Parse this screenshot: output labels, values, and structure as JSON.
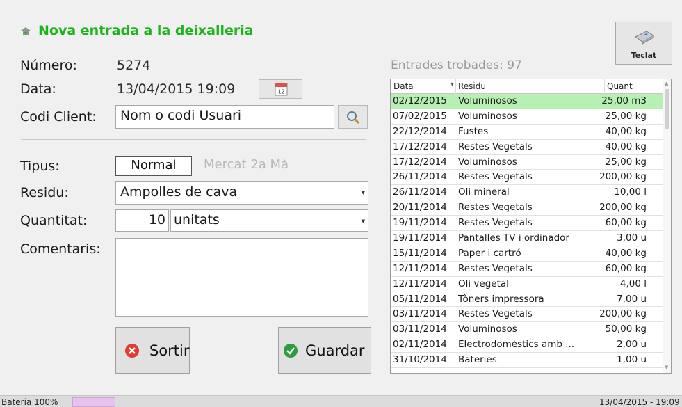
{
  "header": {
    "title": "Nova entrada a la deixalleria"
  },
  "form": {
    "numero_label": "Número:",
    "numero_value": "5274",
    "data_label": "Data:",
    "data_value": "13/04/2015 19:09",
    "codi_label": "Codi Client:",
    "codi_value": "Nom o codi Usuari",
    "tipus_label": "Tipus:",
    "tipus_options": [
      "Normal",
      "Mercat 2a Mà"
    ],
    "tipus_selected": "Normal",
    "residu_label": "Residu:",
    "residu_value": "Ampolles de cava",
    "quantitat_label": "Quantitat:",
    "quantitat_value": "10",
    "unit_value": "unitats",
    "comentaris_label": "Comentaris:",
    "comentaris_value": ""
  },
  "buttons": {
    "sortir": "Sortir",
    "guardar": "Guardar",
    "teclat": "Teclat"
  },
  "calendar_badge": "12",
  "list": {
    "found_text": "Entrades trobades: 97",
    "headers": {
      "data": "Data",
      "residu": "Residu",
      "quant": "Quant"
    },
    "rows": [
      {
        "date": "02/12/2015",
        "residu": "Voluminosos",
        "quant": "25,00 m3",
        "selected": true
      },
      {
        "date": "07/02/2015",
        "residu": "Voluminosos",
        "quant": "25,00 kg"
      },
      {
        "date": "22/12/2014",
        "residu": "Fustes",
        "quant": "40,00 kg"
      },
      {
        "date": "17/12/2014",
        "residu": "Restes Vegetals",
        "quant": "40,00 kg"
      },
      {
        "date": "17/12/2014",
        "residu": "Voluminosos",
        "quant": "25,00 kg"
      },
      {
        "date": "26/11/2014",
        "residu": "Restes Vegetals",
        "quant": "200,00 kg"
      },
      {
        "date": "26/11/2014",
        "residu": "Oli mineral",
        "quant": "10,00 l"
      },
      {
        "date": "20/11/2014",
        "residu": "Restes Vegetals",
        "quant": "200,00 kg"
      },
      {
        "date": "19/11/2014",
        "residu": "Restes Vegetals",
        "quant": "60,00 kg"
      },
      {
        "date": "19/11/2014",
        "residu": "Pantalles TV i ordinador",
        "quant": "3,00 u"
      },
      {
        "date": "15/11/2014",
        "residu": "Paper i cartró",
        "quant": "40,00 kg"
      },
      {
        "date": "12/11/2014",
        "residu": "Restes Vegetals",
        "quant": "60,00 kg"
      },
      {
        "date": "12/11/2014",
        "residu": "Oli vegetal",
        "quant": "4,00 l"
      },
      {
        "date": "05/11/2014",
        "residu": "Tòners impressora",
        "quant": "7,00 u"
      },
      {
        "date": "03/11/2014",
        "residu": "Restes Vegetals",
        "quant": "200,00 kg"
      },
      {
        "date": "03/11/2014",
        "residu": "Voluminosos",
        "quant": "50,00 kg"
      },
      {
        "date": "02/11/2014",
        "residu": "Electrodomèstics amb ...",
        "quant": "2,00 u"
      },
      {
        "date": "31/10/2014",
        "residu": "Bateries",
        "quant": "1,00 u"
      }
    ]
  },
  "statusbar": {
    "battery": "Bateria 100%",
    "clock": "13/04/2015 - 19:09"
  },
  "colors": {
    "title": "#19b519",
    "selected_row": "#b6f0b3",
    "battery_fill": "#e6c3ee"
  },
  "icons": [
    "recycle-icon",
    "calendar-icon",
    "search-icon",
    "keyboard-icon",
    "close-icon",
    "check-icon"
  ]
}
